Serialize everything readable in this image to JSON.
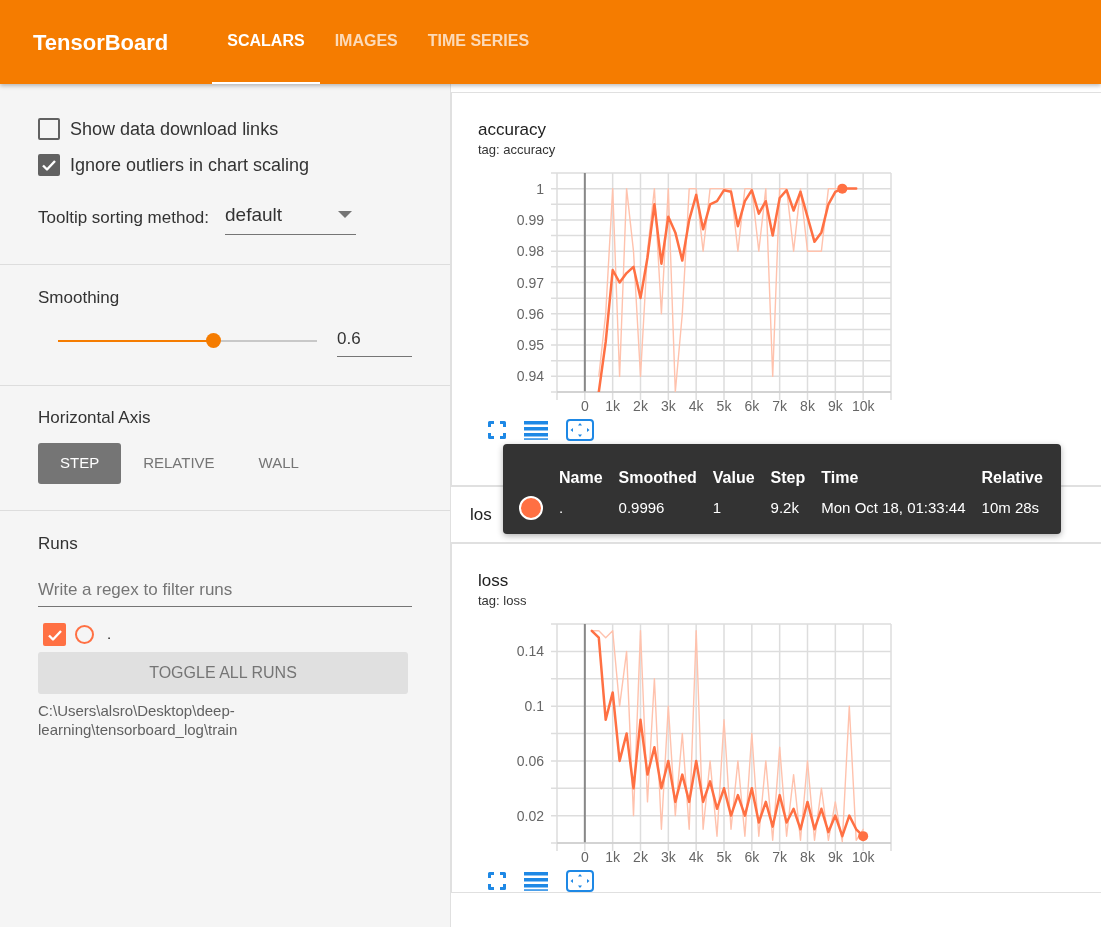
{
  "header": {
    "title": "TensorBoard",
    "tabs": [
      {
        "label": "SCALARS",
        "selected": true
      },
      {
        "label": "IMAGES",
        "selected": false
      },
      {
        "label": "TIME SERIES",
        "selected": false
      }
    ]
  },
  "sidebar": {
    "options": [
      {
        "label": "Show data download links",
        "checked": false
      },
      {
        "label": "Ignore outliers in chart scaling",
        "checked": true
      }
    ],
    "tooltip_sorting": {
      "label": "Tooltip sorting method:",
      "value": "default"
    },
    "smoothing": {
      "title": "Smoothing",
      "level": 0.6,
      "value": "0.6"
    },
    "horizontal_axis": {
      "title": "Horizontal Axis",
      "options": [
        {
          "label": "STEP",
          "selected": true
        },
        {
          "label": "RELATIVE",
          "selected": false
        },
        {
          "label": "WALL",
          "selected": false
        }
      ]
    },
    "runs": {
      "title": "Runs",
      "placeholder": "Write a regex to filter runs",
      "items": [
        {
          "name": ".",
          "checked": true,
          "color": "#ff7043"
        }
      ],
      "toggle_button": "TOGGLE ALL RUNS",
      "path": "C:\\Users\\alsro\\Desktop\\deep-learning\\tensorboard_log\\train"
    }
  },
  "sections": [
    {
      "kind": "chart_card",
      "title": "accuracy",
      "tag": "tag: accuracy",
      "chart_data": {
        "type": "line",
        "xlim": [
          -1000,
          11000
        ],
        "ylim": [
          0.935,
          1.005
        ],
        "xticks": [
          {
            "value": 0,
            "label": "0"
          },
          {
            "value": 1000,
            "label": "1k"
          },
          {
            "value": 2000,
            "label": "2k"
          },
          {
            "value": 3000,
            "label": "3k"
          },
          {
            "value": 4000,
            "label": "4k"
          },
          {
            "value": 5000,
            "label": "5k"
          },
          {
            "value": 6000,
            "label": "6k"
          },
          {
            "value": 7000,
            "label": "7k"
          },
          {
            "value": 8000,
            "label": "8k"
          },
          {
            "value": 9000,
            "label": "9k"
          },
          {
            "value": 10000,
            "label": "10k"
          }
        ],
        "yticks": [
          0.94,
          0.95,
          0.96,
          0.97,
          0.98,
          0.99,
          1
        ],
        "x": [
          500,
          750,
          1000,
          1250,
          1500,
          1750,
          2000,
          2250,
          2500,
          2750,
          3000,
          3250,
          3500,
          3750,
          4000,
          4250,
          4500,
          4750,
          5000,
          5250,
          5500,
          5750,
          6000,
          6250,
          6500,
          6750,
          7000,
          7250,
          7500,
          7750,
          8000,
          8250,
          8500,
          8750,
          9000,
          9250,
          9500,
          9750
        ],
        "series": [
          {
            "color": "#ff7043",
            "values": [
              0.935,
              0.951,
              0.974,
              0.97,
              0.973,
              0.975,
              0.965,
              0.978,
              0.995,
              0.976,
              0.991,
              0.986,
              0.977,
              0.99,
              0.998,
              0.987,
              0.995,
              0.996,
              0.9995,
              0.999,
              0.988,
              0.996,
              0.9995,
              0.992,
              0.996,
              0.985,
              0.997,
              0.9995,
              0.993,
              0.999,
              0.991,
              0.983,
              0.986,
              0.995,
              0.999,
              1,
              1,
              1
            ]
          },
          {
            "color": "#ffc2ad",
            "values": [
              0.94,
              0.96,
              1,
              0.94,
              1,
              0.98,
              0.94,
              0.98,
              1,
              0.96,
              1,
              0.935,
              0.96,
              1,
              1,
              0.98,
              1,
              1,
              1,
              1,
              0.98,
              1,
              1,
              0.98,
              1,
              0.94,
              1,
              1,
              0.98,
              1,
              0.98,
              0.98,
              0.98,
              1,
              1,
              1,
              1,
              1
            ]
          },
          {
            "marker": true,
            "color": "#ff7043",
            "values": [
              null,
              null,
              null,
              null,
              null,
              null,
              null,
              null,
              null,
              null,
              null,
              null,
              null,
              null,
              null,
              null,
              null,
              null,
              null,
              null,
              null,
              null,
              null,
              null,
              null,
              null,
              null,
              null,
              null,
              null,
              null,
              null,
              null,
              null,
              null,
              1,
              null,
              null
            ]
          }
        ],
        "grid": true
      }
    },
    {
      "kind": "group_header",
      "title": "los"
    },
    {
      "kind": "chart_card",
      "title": "loss",
      "tag": "tag: loss",
      "chart_data": {
        "type": "line",
        "xlim": [
          -1000,
          11000
        ],
        "ylim": [
          0,
          0.16
        ],
        "xticks": [
          {
            "value": 0,
            "label": "0"
          },
          {
            "value": 1000,
            "label": "1k"
          },
          {
            "value": 2000,
            "label": "2k"
          },
          {
            "value": 3000,
            "label": "3k"
          },
          {
            "value": 4000,
            "label": "4k"
          },
          {
            "value": 5000,
            "label": "5k"
          },
          {
            "value": 6000,
            "label": "6k"
          },
          {
            "value": 7000,
            "label": "7k"
          },
          {
            "value": 8000,
            "label": "8k"
          },
          {
            "value": 9000,
            "label": "9k"
          },
          {
            "value": 10000,
            "label": "10k"
          }
        ],
        "yticks": [
          0.02,
          0.06,
          0.1,
          0.14
        ],
        "x": [
          250,
          500,
          750,
          1000,
          1250,
          1500,
          1750,
          2000,
          2250,
          2500,
          2750,
          3000,
          3250,
          3500,
          3750,
          4000,
          4250,
          4500,
          4750,
          5000,
          5250,
          5500,
          5750,
          6000,
          6250,
          6500,
          6750,
          7000,
          7250,
          7500,
          7750,
          8000,
          8250,
          8500,
          8750,
          9000,
          9250,
          9500,
          9750,
          10000
        ],
        "series": [
          {
            "color": "#ff7043",
            "values": [
              0.155,
              0.15,
              0.09,
              0.11,
              0.06,
              0.08,
              0.04,
              0.09,
              0.05,
              0.07,
              0.04,
              0.06,
              0.03,
              0.05,
              0.03,
              0.06,
              0.03,
              0.045,
              0.025,
              0.04,
              0.02,
              0.035,
              0.02,
              0.04,
              0.015,
              0.03,
              0.012,
              0.035,
              0.015,
              0.025,
              0.01,
              0.03,
              0.01,
              0.025,
              0.008,
              0.02,
              0.005,
              0.02,
              0.01,
              0.005
            ]
          },
          {
            "color": "#ffc2ad",
            "values": [
              0.155,
              0.155,
              0.15,
              0.155,
              0.1,
              0.14,
              0.02,
              0.155,
              0.03,
              0.12,
              0.01,
              0.1,
              0.02,
              0.08,
              0.01,
              0.155,
              0.01,
              0.06,
              0.005,
              0.09,
              0.01,
              0.06,
              0.005,
              0.08,
              0.005,
              0.06,
              0.002,
              0.07,
              0.005,
              0.05,
              0.002,
              0.06,
              0.002,
              0.04,
              0.002,
              0.03,
              0.001,
              0.1,
              0.002,
              0.01
            ]
          },
          {
            "marker": true,
            "color": "#ff7043",
            "values": [
              null,
              null,
              null,
              null,
              null,
              null,
              null,
              null,
              null,
              null,
              null,
              null,
              null,
              null,
              null,
              null,
              null,
              null,
              null,
              null,
              null,
              null,
              null,
              null,
              null,
              null,
              null,
              null,
              null,
              null,
              null,
              null,
              null,
              null,
              null,
              null,
              null,
              null,
              null,
              0.005
            ]
          }
        ],
        "grid": true
      }
    }
  ],
  "tooltip": {
    "columns": [
      "Name",
      "Smoothed",
      "Value",
      "Step",
      "Time",
      "Relative"
    ],
    "rows": [
      {
        "color": "#ff7043",
        "cells": [
          ".",
          "0.9996",
          "1",
          "9.2k",
          "Mon Oct 18, 01:33:44",
          "10m 28s"
        ]
      }
    ]
  }
}
